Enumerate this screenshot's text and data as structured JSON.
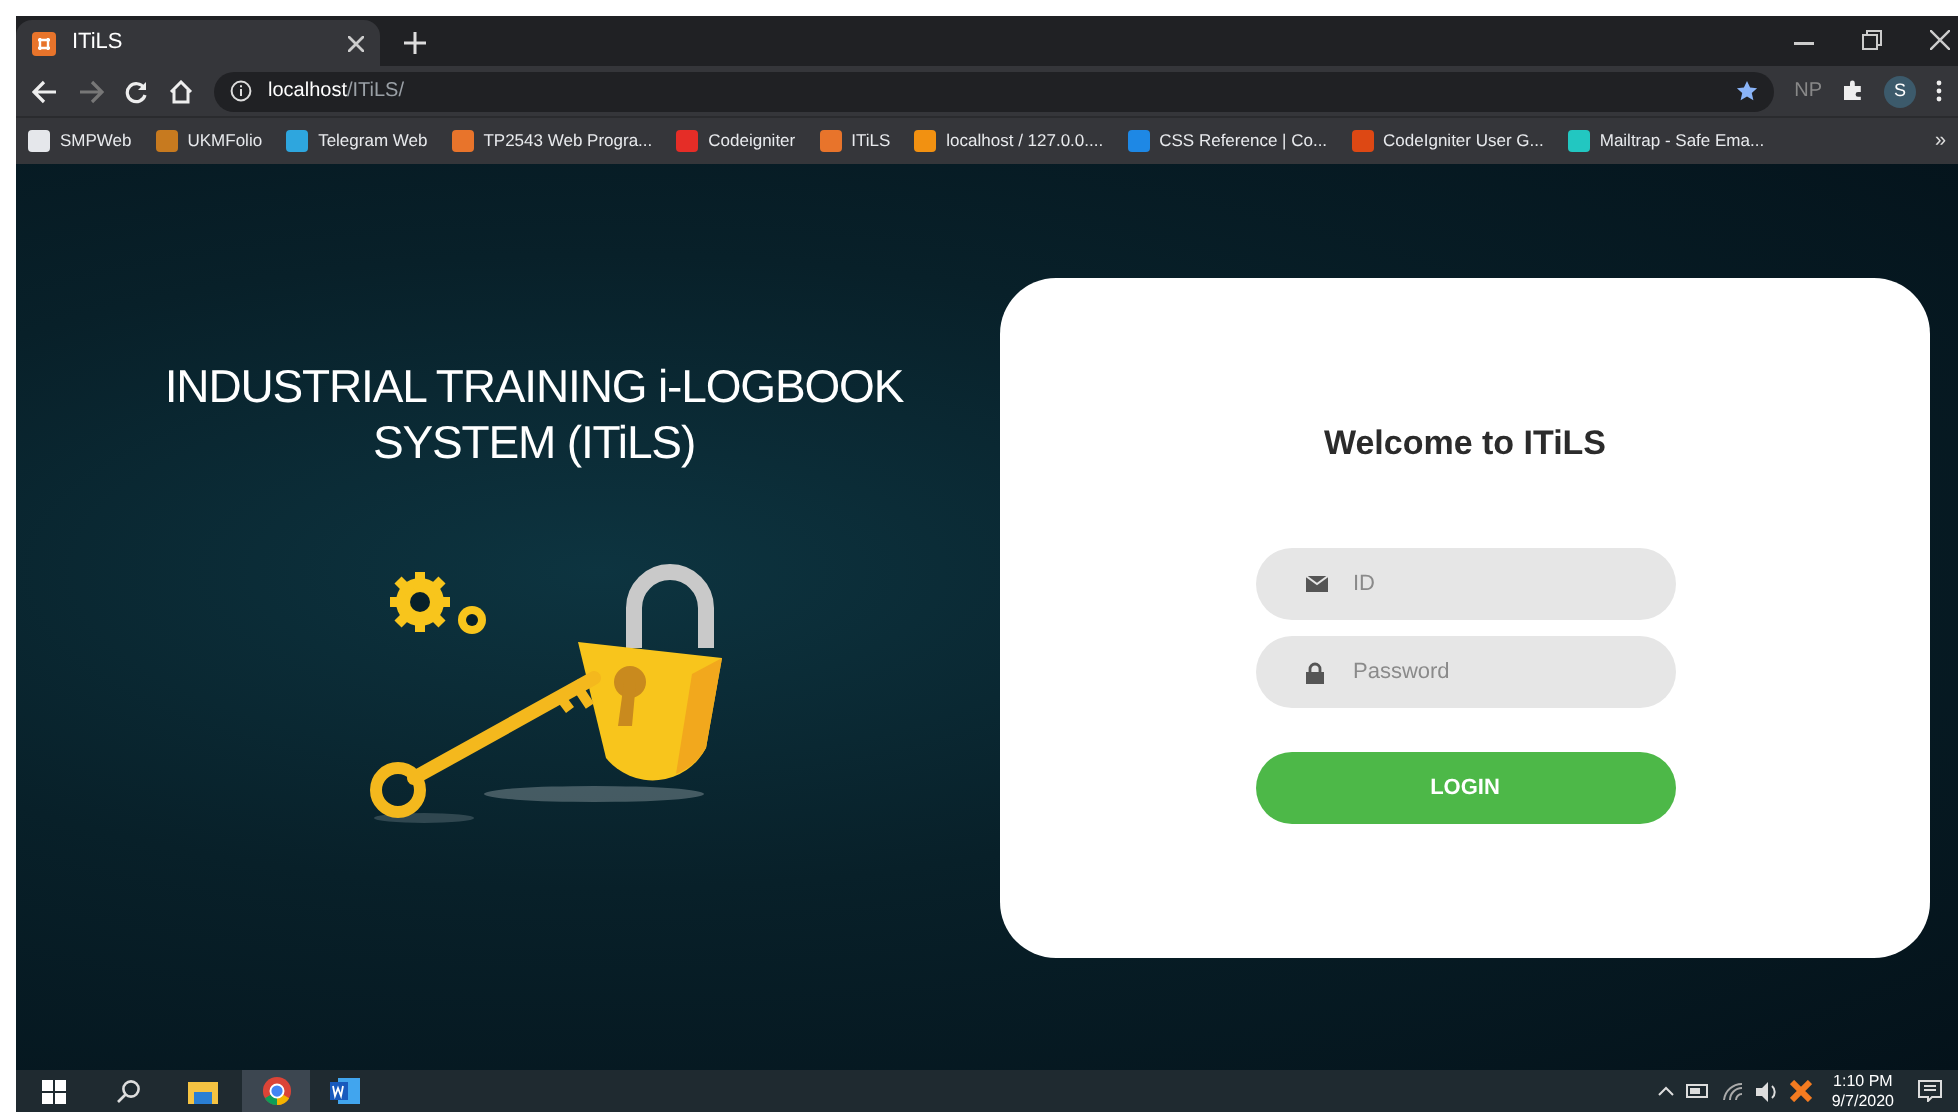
{
  "browser": {
    "tab": {
      "title": "ITiLS",
      "selected": true
    },
    "address": {
      "host": "localhost",
      "path": "/ITiLS/"
    },
    "bookmarked": true,
    "extension_label": "NP",
    "profile_initial": "S",
    "bookmarks": [
      {
        "label": "SMPWeb",
        "color": "#e5e7eb"
      },
      {
        "label": "UKMFolio",
        "color": "#c77a1f"
      },
      {
        "label": "Telegram Web",
        "color": "#2ea6de"
      },
      {
        "label": "TP2543 Web Progra...",
        "color": "#e8742b"
      },
      {
        "label": "Codeigniter",
        "color": "#e52d27"
      },
      {
        "label": "ITiLS",
        "color": "#e8742b"
      },
      {
        "label": "localhost / 127.0.0....",
        "color": "#f29111"
      },
      {
        "label": "CSS Reference | Co...",
        "color": "#1e88e5"
      },
      {
        "label": "CodeIgniter User G...",
        "color": "#dd4814"
      },
      {
        "label": "Mailtrap - Safe Ema...",
        "color": "#22c7c1"
      }
    ],
    "overflow": "»"
  },
  "page": {
    "heading_lines": [
      "INDUSTRIAL TRAINING i-LOGBOOK",
      "SYSTEM (ITiLS)"
    ],
    "login": {
      "title": "Welcome to ITiLS",
      "fields": [
        {
          "kind": "id",
          "placeholder": "ID"
        },
        {
          "kind": "password",
          "placeholder": "Password"
        }
      ],
      "button": "LOGIN"
    }
  },
  "taskbar": {
    "time": "1:10 PM",
    "date": "9/7/2020"
  }
}
